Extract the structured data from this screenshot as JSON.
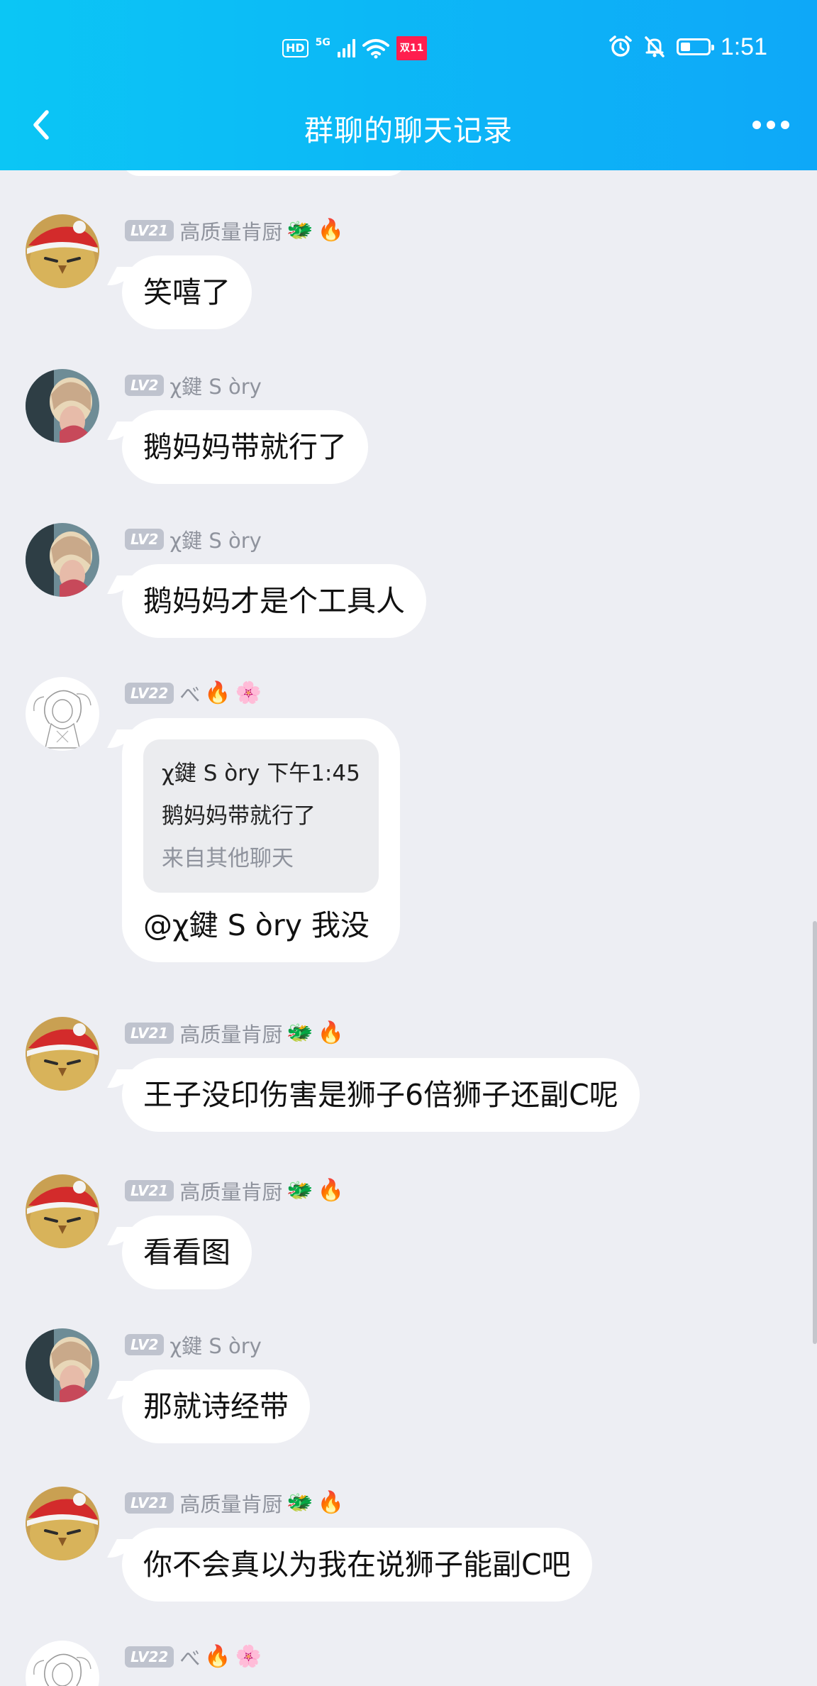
{
  "status_bar": {
    "hd": "HD",
    "network": "5G",
    "badge": "双11",
    "time": "1:51",
    "battery_level": 0.38
  },
  "nav": {
    "title": "群聊的聊天记录"
  },
  "messages": [
    {
      "level": "LV21",
      "nick": "高质量肯厨",
      "icons": [
        "dragon-icon",
        "fire-icon"
      ],
      "text": "笑嘻了"
    },
    {
      "level": "LV2",
      "nick": "χ鍵 S òry",
      "icons": [],
      "text": "鹅妈妈带就行了"
    },
    {
      "level": "LV2",
      "nick": "χ鍵 S òry",
      "icons": [],
      "text": "鹅妈妈才是个工具人"
    },
    {
      "level": "LV22",
      "nick": "べ",
      "icons": [
        "fire-icon",
        "flower-icon"
      ],
      "quote": {
        "header": "χ鍵 S òry 下午1:45",
        "body": "鹅妈妈带就行了",
        "source": "来自其他聊天"
      },
      "text": "@χ鍵 S òry 我没"
    },
    {
      "level": "LV21",
      "nick": "高质量肯厨",
      "icons": [
        "dragon-icon",
        "fire-icon"
      ],
      "text": "王子没印伤害是狮子6倍狮子还副C呢"
    },
    {
      "level": "LV21",
      "nick": "高质量肯厨",
      "icons": [
        "dragon-icon",
        "fire-icon"
      ],
      "text": "看看图"
    },
    {
      "level": "LV2",
      "nick": "χ鍵 S òry",
      "icons": [],
      "text": "那就诗经带"
    },
    {
      "level": "LV21",
      "nick": "高质量肯厨",
      "icons": [
        "dragon-icon",
        "fire-icon"
      ],
      "text": "你不会真以为我在说狮子能副C吧"
    },
    {
      "level": "LV22",
      "nick": "べ",
      "icons": [
        "fire-icon",
        "flower-icon"
      ],
      "text": ""
    }
  ]
}
